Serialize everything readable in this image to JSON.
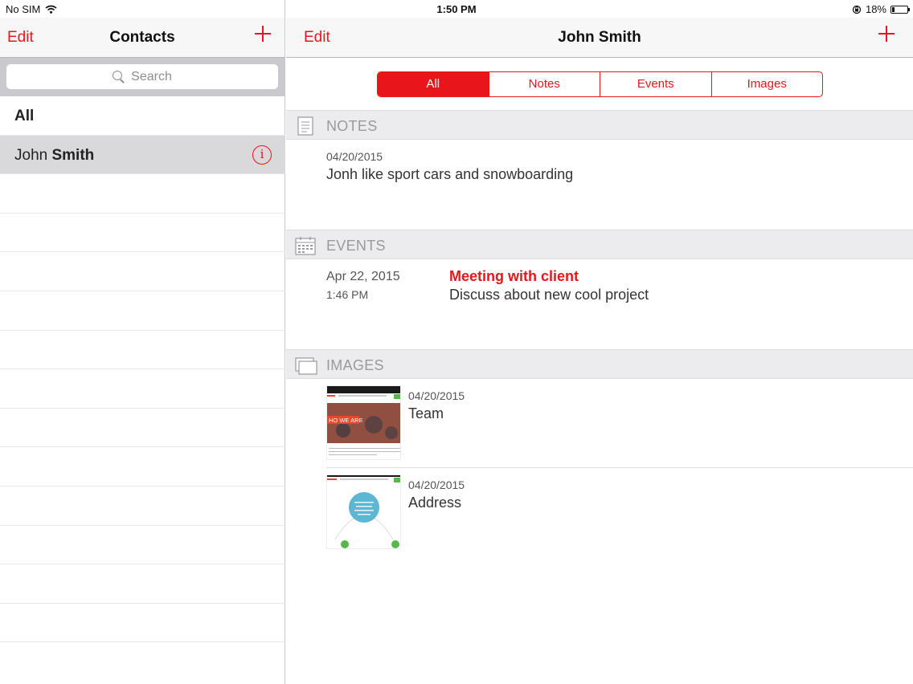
{
  "status_bar": {
    "carrier": "No SIM",
    "time": "1:50 PM",
    "battery": "18%",
    "battery_level": 0.18
  },
  "contacts_pane": {
    "edit_label": "Edit",
    "title": "Contacts",
    "search_placeholder": "Search",
    "items": [
      {
        "label": "All"
      },
      {
        "first": "John ",
        "last": "Smith"
      }
    ]
  },
  "detail_pane": {
    "edit_label": "Edit",
    "title": "John Smith",
    "segments": [
      "All",
      "Notes",
      "Events",
      "Images"
    ],
    "active_segment": "All",
    "notes": {
      "header": "NOTES",
      "items": [
        {
          "date": "04/20/2015",
          "text": "Jonh like sport cars and snowboarding"
        }
      ]
    },
    "events": {
      "header": "EVENTS",
      "items": [
        {
          "date": "Apr 22, 2015",
          "time": "1:46 PM",
          "title": "Meeting with client",
          "description": "Discuss about new cool project"
        }
      ]
    },
    "images": {
      "header": "IMAGES",
      "items": [
        {
          "date": "04/20/2015",
          "title": "Team",
          "thumb_text": "HO WE ARE"
        },
        {
          "date": "04/20/2015",
          "title": "Address"
        }
      ]
    }
  },
  "colors": {
    "accent": "#e8161b",
    "header_bg": "#ececee",
    "selected_row": "#d9d9dc"
  }
}
